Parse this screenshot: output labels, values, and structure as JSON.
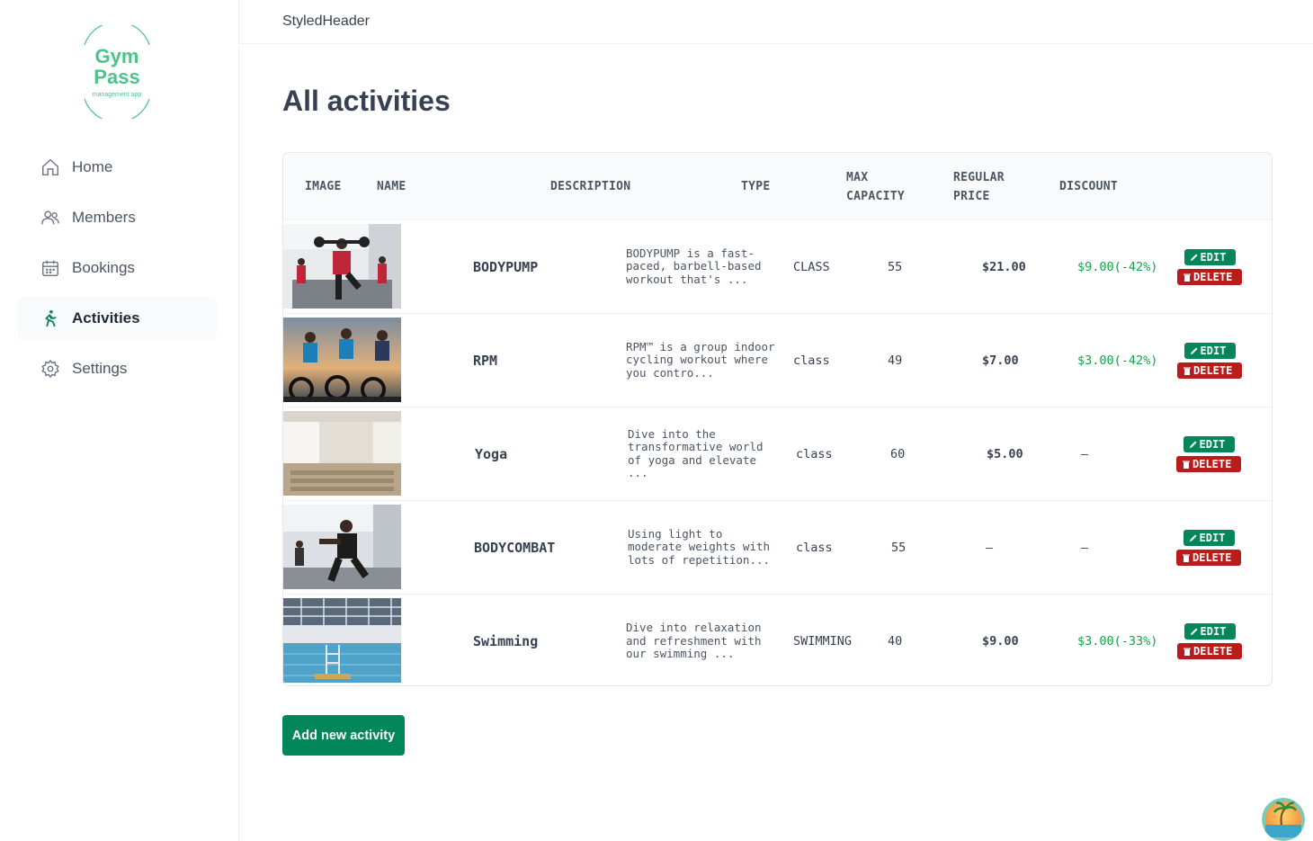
{
  "app": {
    "header": "StyledHeader",
    "logo_line1": "Gym",
    "logo_line2": "Pass",
    "logo_sub": "management app"
  },
  "sidebar": {
    "items": [
      {
        "label": "Home",
        "icon": "home-icon"
      },
      {
        "label": "Members",
        "icon": "members-icon"
      },
      {
        "label": "Bookings",
        "icon": "calendar-icon"
      },
      {
        "label": "Activities",
        "icon": "activity-icon",
        "active": true
      },
      {
        "label": "Settings",
        "icon": "gear-icon"
      }
    ]
  },
  "main": {
    "title": "All activities",
    "columns": [
      "IMAGE",
      "NAME",
      "DESCRIPTION",
      "TYPE",
      "MAX",
      "CAPACITY",
      "REGULAR",
      "PRICE",
      "DISCOUNT"
    ],
    "rows": [
      {
        "name": "BODYPUMP",
        "description": "BODYPUMP is a fast-\npaced, barbell-based\nworkout that's ...",
        "type": "CLASS",
        "capacity": "55",
        "price": "$21.00",
        "discount": "$9.00(-42%)",
        "edit": "EDIT",
        "delete": "DELETE"
      },
      {
        "name": "RPM",
        "description": "RPM™ is a group indoor\ncycling workout where\nyou contro...",
        "type": "class",
        "capacity": "49",
        "price": "$7.00",
        "discount": "$3.00(-42%)",
        "edit": "EDIT",
        "delete": "DELETE"
      },
      {
        "name": "Yoga",
        "description": "Dive into the\ntransformative world\nof yoga and elevate\n...",
        "type": "class",
        "capacity": "60",
        "price": "$5.00",
        "discount": "–",
        "edit": "EDIT",
        "delete": "DELETE"
      },
      {
        "name": "BODYCOMBAT",
        "description": "Using light to\nmoderate weights with\nlots of repetition...",
        "type": "class",
        "capacity": "55",
        "price": "–",
        "discount": "–",
        "edit": "EDIT",
        "delete": "DELETE"
      },
      {
        "name": "Swimming",
        "description": "Dive into relaxation\nand refreshment with\nour swimming ...",
        "type": "SWIMMING",
        "capacity": "40",
        "price": "$9.00",
        "discount": "$3.00(-33%)",
        "edit": "EDIT",
        "delete": "DELETE"
      }
    ],
    "add_button": "Add new activity"
  },
  "colors": {
    "accent": "#03875a",
    "danger": "#b91c1c",
    "discount": "#16a34a",
    "logo": "#4ac58a"
  }
}
